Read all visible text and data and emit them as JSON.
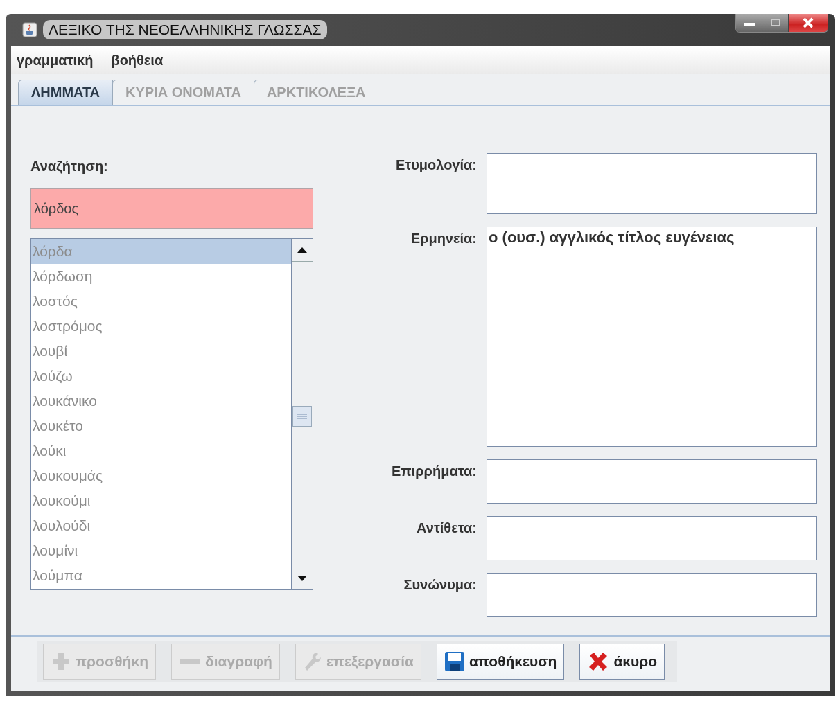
{
  "window": {
    "title": "ΛΕΞΙΚΟ ΤΗΣ ΝΕΟΕΛΛΗΝΙΚΗΣ ΓΛΩΣΣΑΣ"
  },
  "menu": [
    "γραμματική",
    "βοήθεια"
  ],
  "tabs": [
    {
      "label": "ΛΗΜΜΑΤΑ",
      "selected": true
    },
    {
      "label": "ΚΥΡΙΑ ΟΝΟΜΑΤΑ",
      "selected": false
    },
    {
      "label": "ΑΡΚΤΙΚΟΛΕΞΑ",
      "selected": false
    }
  ],
  "search": {
    "label": "Αναζήτηση:",
    "value": "λόρδος"
  },
  "words": [
    {
      "text": "λόρδα",
      "selected": true
    },
    {
      "text": "λόρδωση",
      "selected": false
    },
    {
      "text": "λοστός",
      "selected": false
    },
    {
      "text": "λοστρόμος",
      "selected": false
    },
    {
      "text": "λουβί",
      "selected": false
    },
    {
      "text": "λούζω",
      "selected": false
    },
    {
      "text": "λουκάνικο",
      "selected": false
    },
    {
      "text": "λουκέτο",
      "selected": false
    },
    {
      "text": "λούκι",
      "selected": false
    },
    {
      "text": "λουκουμάς",
      "selected": false
    },
    {
      "text": "λουκούμι",
      "selected": false
    },
    {
      "text": "λουλούδι",
      "selected": false
    },
    {
      "text": "λουμίνι",
      "selected": false
    },
    {
      "text": "λούμπα",
      "selected": false
    }
  ],
  "fields": [
    {
      "label": "Ετυμολογία:"
    },
    {
      "label": "Ερμηνεία:",
      "value": "ο (ουσ.) αγγλικός τίτλος ευγένειας"
    },
    {
      "label": "Επιρρήματα:"
    },
    {
      "label": "Αντίθετα:"
    },
    {
      "label": "Συνώνυμα:"
    }
  ],
  "buttons": [
    {
      "label": "προσθήκη",
      "kind": "add",
      "disabled": true
    },
    {
      "label": "διαγραφή",
      "kind": "remove",
      "disabled": true
    },
    {
      "label": "επεξεργασία",
      "kind": "edit",
      "disabled": true
    },
    {
      "label": "αποθήκευση",
      "kind": "save",
      "disabled": false
    },
    {
      "label": "άκυρο",
      "kind": "cancel",
      "disabled": false
    }
  ]
}
